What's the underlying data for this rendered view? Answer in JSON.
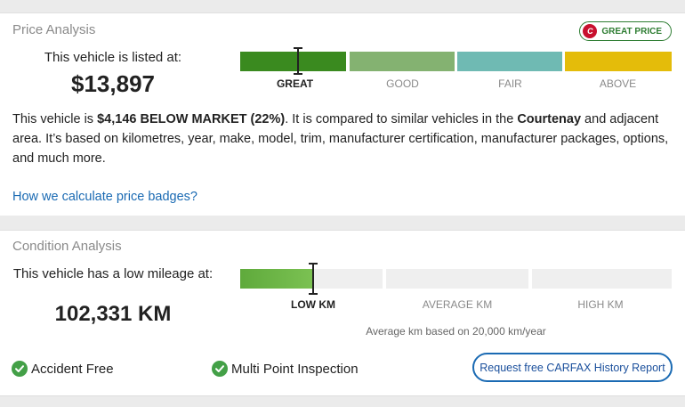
{
  "price": {
    "title": "Price Analysis",
    "badge": {
      "label": "GREAT PRICE",
      "logo_text": "C"
    },
    "listed_label": "This vehicle is listed at:",
    "listed_price": "$13,897",
    "scale": {
      "labels": [
        "GREAT",
        "GOOD",
        "FAIR",
        "ABOVE"
      ],
      "colors": [
        "#3a8a1f",
        "#84b271",
        "#6fbab3",
        "#e4bc0a"
      ],
      "active": "GREAT"
    },
    "description": {
      "part1": "This vehicle is ",
      "bold1": "$4,146 BELOW MARKET (22%)",
      "part2": ". It is compared to similar vehicles in the ",
      "bold2": "Courtenay",
      "part3": " and adjacent area. It’s based on kilometres, year, make, model, trim, manufacturer certification, manufacturer packages, options, and much more."
    },
    "link": "How we calculate price badges?"
  },
  "condition": {
    "title": "Condition Analysis",
    "mileage_label": "This vehicle has a low mileage at:",
    "mileage_value": "102,331 KM",
    "scale": {
      "labels": [
        "LOW KM",
        "AVERAGE KM",
        "HIGH KM"
      ],
      "active": "LOW KM",
      "fill_color": "#5faa3c",
      "track_color": "#efefef"
    },
    "note": "Average km based on 20,000 km/year",
    "checks": [
      "Accident Free",
      "Multi Point Inspection"
    ],
    "report_button": "Request free CARFAX History Report"
  },
  "icons": {
    "check": "check-circle-icon",
    "badge_logo": "carfax-logo-icon"
  }
}
